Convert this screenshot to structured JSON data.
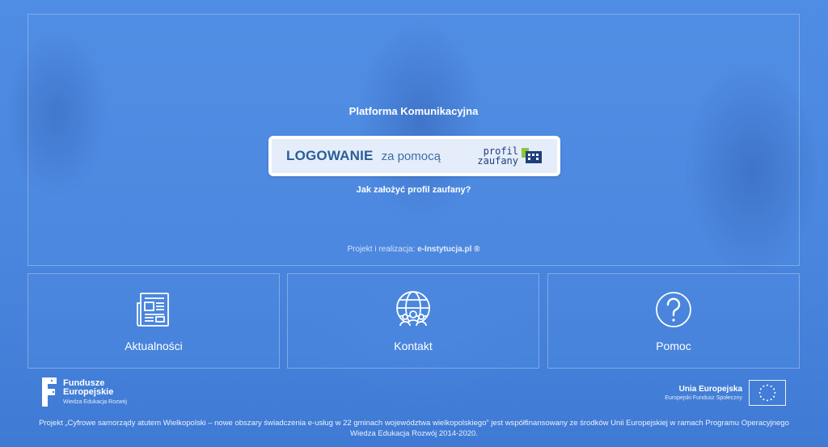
{
  "main": {
    "title": "Platforma Komunikacyjna",
    "login": {
      "strong": "LOGOWANIE",
      "via": "za pomocą",
      "logo_line1": "profil",
      "logo_line2": "zaufany"
    },
    "help_link": "Jak założyć profil zaufany?",
    "credits_prefix": "Projekt i realizacja: ",
    "credits_brand": "e-Instytucja.pl ®"
  },
  "tiles": [
    {
      "label": "Aktualności",
      "icon": "newspaper-icon"
    },
    {
      "label": "Kontakt",
      "icon": "globe-people-icon"
    },
    {
      "label": "Pomoc",
      "icon": "question-circle-icon"
    }
  ],
  "footer": {
    "fe_line1": "Fundusze",
    "fe_line2": "Europejskie",
    "fe_line3": "Wiedza Edukacja Rozwój",
    "eu_line1": "Unia Europejska",
    "eu_line2": "Europejski Fundusz Społeczny",
    "text": "Projekt „Cyfrowe samorządy atutem Wielkopolski – nowe obszary świadczenia e-usług w 22 gminach województwa wielkopolskiego” jest współfinansowany ze środków Unii Europejskiej w ramach Programu Operacyjnego Wiedza Edukacja Rozwój 2014-2020."
  },
  "colors": {
    "background": "#4a86de",
    "login_bg": "#e4edf9",
    "login_text": "#2a5d98",
    "pz_green": "#8cc63f"
  }
}
